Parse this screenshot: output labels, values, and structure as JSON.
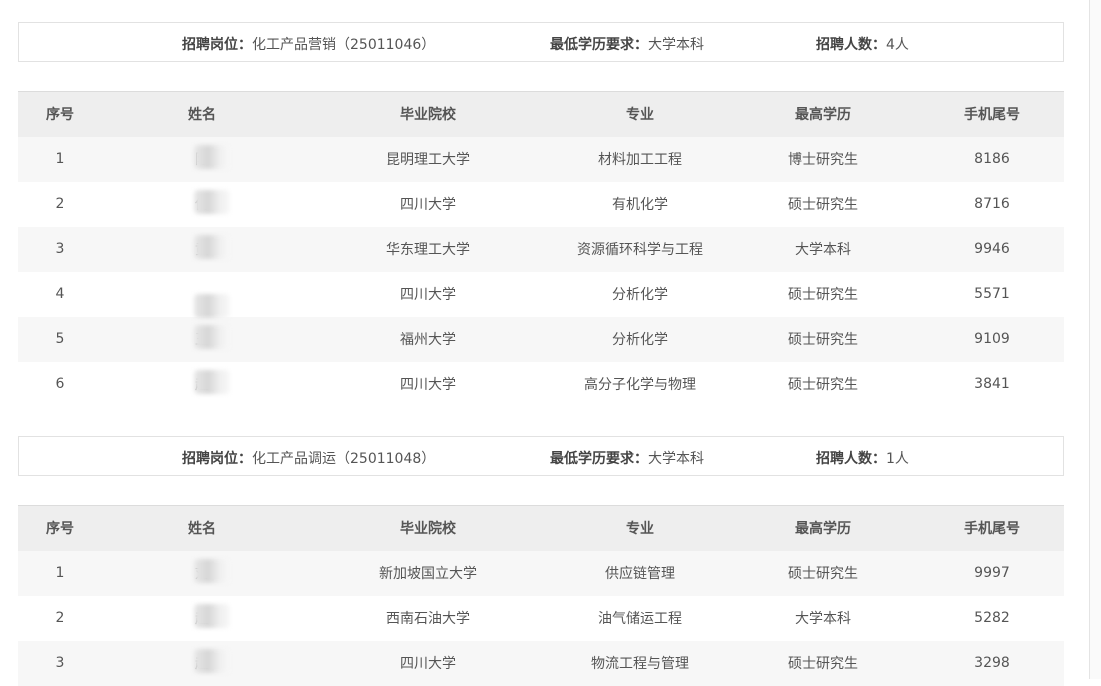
{
  "labels": {
    "position_key": "招聘岗位：",
    "edu_key": "最低学历要求：",
    "count_key": "招聘人数："
  },
  "columns": [
    "序号",
    "姓名",
    "毕业院校",
    "专业",
    "最高学历",
    "手机尾号"
  ],
  "sections": [
    {
      "position": "化工产品营销（25011046）",
      "min_edu": "大学本科",
      "count": "4人",
      "rows": [
        [
          "1",
          "陈",
          "昆明理工大学",
          "材料加工工程",
          "博士研究生",
          "8186"
        ],
        [
          "2",
          "佟",
          "四川大学",
          "有机化学",
          "硕士研究生",
          "8716"
        ],
        [
          "3",
          "黄",
          "华东理工大学",
          "资源循环科学与工程",
          "大学本科",
          "9946"
        ],
        [
          "4",
          "",
          "四川大学",
          "分析化学",
          "硕士研究生",
          "5571"
        ],
        [
          "5",
          "王",
          "福州大学",
          "分析化学",
          "硕士研究生",
          "9109"
        ],
        [
          "6",
          "赵",
          "四川大学",
          "高分子化学与物理",
          "硕士研究生",
          "3841"
        ]
      ]
    },
    {
      "position": "化工产品调运（25011048）",
      "min_edu": "大学本科",
      "count": "1人",
      "rows": [
        [
          "1",
          "刘",
          "新加坡国立大学",
          "供应链管理",
          "硕士研究生",
          "9997"
        ],
        [
          "2",
          "赵",
          "西南石油大学",
          "油气储运工程",
          "大学本科",
          "5282"
        ],
        [
          "3",
          "赵",
          "四川大学",
          "物流工程与管理",
          "硕士研究生",
          "3298"
        ]
      ]
    }
  ]
}
